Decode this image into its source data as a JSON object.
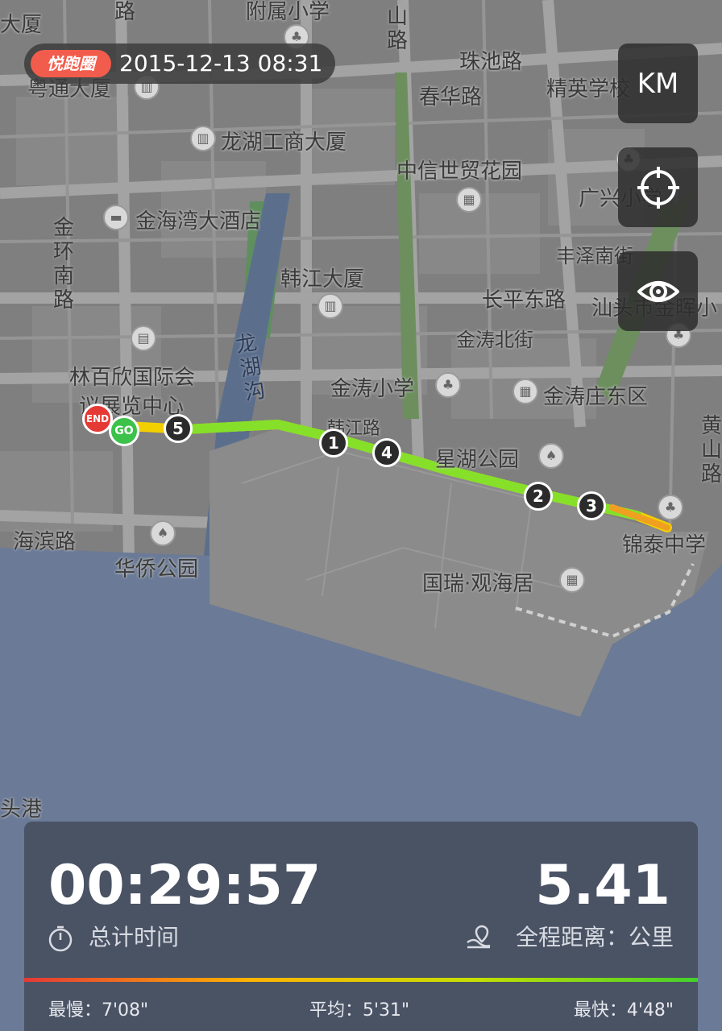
{
  "header": {
    "logo_text": "悦跑圈",
    "datetime": "2015-12-13 08:31"
  },
  "controls": {
    "unit_label": "KM"
  },
  "route": {
    "start_label": "GO",
    "end_label": "END",
    "km_markers": [
      "1",
      "2",
      "3",
      "4",
      "5"
    ]
  },
  "map_labels": {
    "dasha": "大厦",
    "fushu": "附属小学",
    "lu_top": "路",
    "shanlu": "山路",
    "yuetong": "粤通大厦",
    "zhuchi": "珠池路",
    "chunhua": "春华路",
    "jingying": "精英学校",
    "longhu_gs": "龙湖工商大厦",
    "zhongxin": "中信世贸花园",
    "guangxing": "广兴小学",
    "jinhai": "金海湾大酒店",
    "jinhuan": "金环南路",
    "fengze": "丰泽南街",
    "hanjiang_ds": "韩江大厦",
    "changping": "长平东路",
    "shantou_jh": "汕头市金晖小",
    "jintao_bj": "金涛北街",
    "longhugou": "龙湖沟",
    "linbaixin": "林百欣国际会",
    "zhanlan": "议展览中心",
    "jintao_xx": "金涛小学",
    "jintao_zd": "金涛庄东区",
    "hanjiang_l": "韩江路",
    "xinghu": "星湖公园",
    "huangshan": "黄山路",
    "haibin": "海滨路",
    "huaqiao": "华侨公园",
    "jintai": "锦泰中学",
    "guorui": "国瑞·观海居",
    "toutgang": "头港"
  },
  "stats": {
    "total_time": "00:29:57",
    "total_time_label": "总计时间",
    "distance": "5.41",
    "distance_label": "全程距离：公里",
    "slowest": "最慢：7'08\"",
    "average": "平均：5'31\"",
    "fastest": "最快：4'48\""
  },
  "colors": {
    "panel": "#485060",
    "route_fast": "#7ed321",
    "route_slow": "#f5a623",
    "start": "#3cc24a",
    "end": "#e53935"
  }
}
